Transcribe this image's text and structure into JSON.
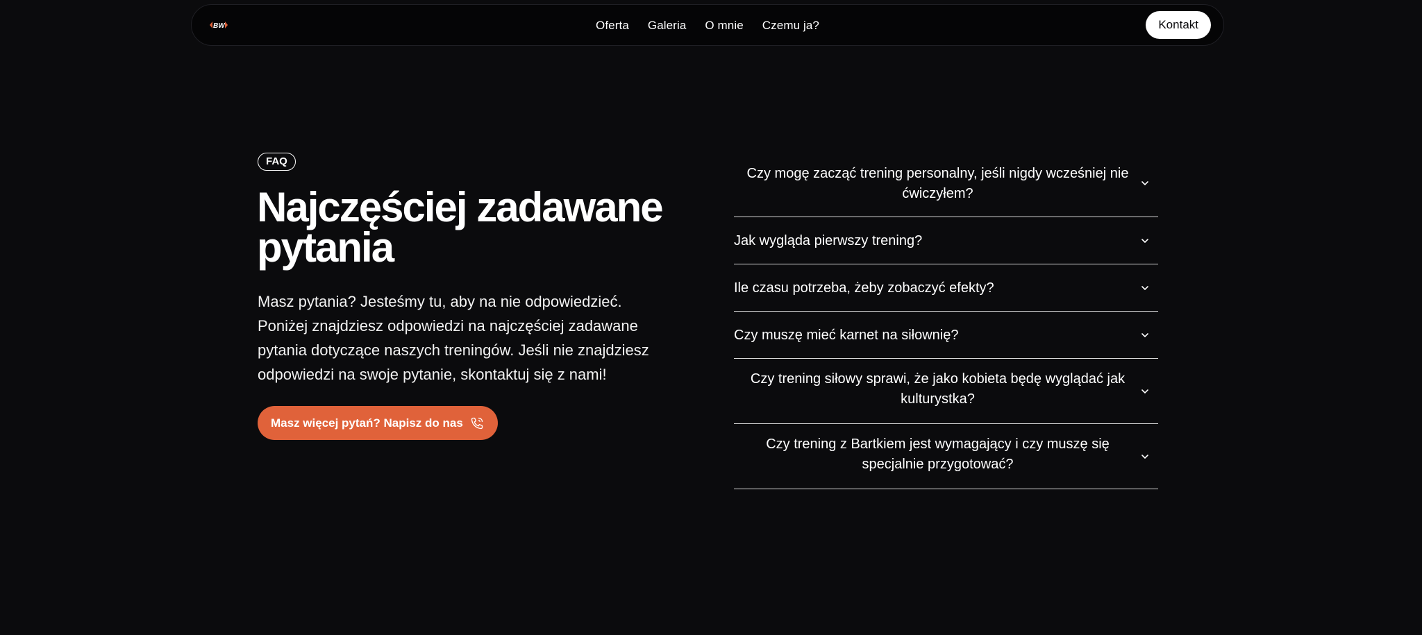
{
  "nav": {
    "logo_text": "BW",
    "links": [
      "Oferta",
      "Galeria",
      "O mnie",
      "Czemu ja?"
    ],
    "contact_label": "Kontakt"
  },
  "faq_section": {
    "badge": "FAQ",
    "title": "Najczęściej zadawane pytania",
    "description": "Masz pytania? Jesteśmy tu, aby na nie odpowiedzieć. Poniżej znajdziesz odpowiedzi na najczęściej zadawane pytania dotyczące naszych treningów. Jeśli nie znajdziesz odpowiedzi na swoje pytanie, skontaktuj się z nami!",
    "cta_label": "Masz więcej pytań? Napisz do nas",
    "cta_icon": "phone-icon",
    "questions": [
      "Czy mogę zacząć trening personalny, jeśli nigdy wcześniej nie ćwiczyłem?",
      "Jak wygląda pierwszy trening?",
      "Ile czasu potrzeba, żeby zobaczyć efekty?",
      "Czy muszę mieć karnet na siłownię?",
      "Czy trening siłowy sprawi, że jako kobieta będę wyglądać jak kulturystka?",
      "Czy trening z Bartkiem jest wymagający i czy muszę się specjalnie przygotować?"
    ]
  },
  "colors": {
    "background": "#0b0b0d",
    "accent": "#e0623a",
    "text": "#ffffff"
  }
}
